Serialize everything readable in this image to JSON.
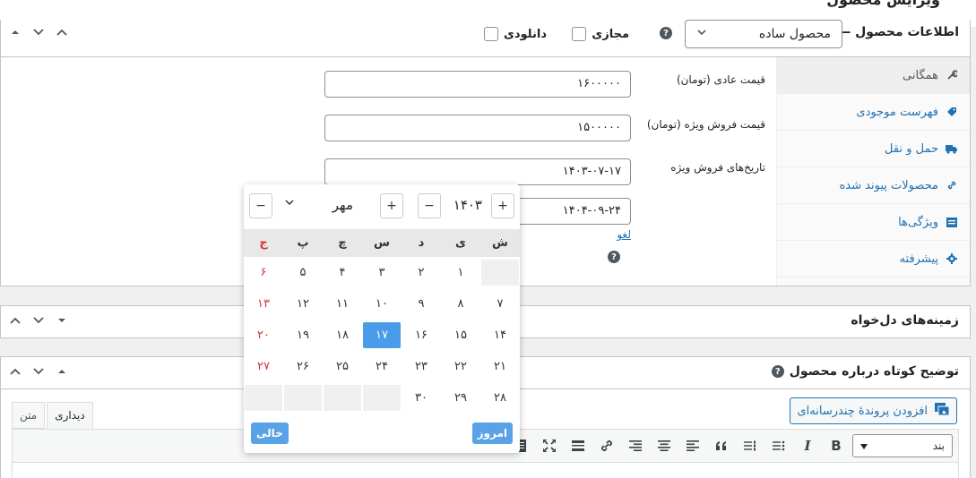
{
  "page": {
    "title": "ویرایش محصول"
  },
  "product_data": {
    "title": "اطلاعات محصول —",
    "type_select": "محصول ساده",
    "virtual_label": "مجازی",
    "downloadable_label": "دانلودی",
    "tabs": [
      {
        "label": "همگانی",
        "icon": "wrench-icon"
      },
      {
        "label": "فهرست موجودی",
        "icon": "tag-icon"
      },
      {
        "label": "حمل و نقل",
        "icon": "truck-icon"
      },
      {
        "label": "محصولات پیوند شده",
        "icon": "link-icon"
      },
      {
        "label": "ویژگی‌ها",
        "icon": "list-icon"
      },
      {
        "label": "پیشرفته",
        "icon": "gear-icon"
      }
    ],
    "regular_price_label": "قیمت عادی (تومان)",
    "regular_price_value": "۱۶۰۰۰۰۰",
    "sale_price_label": "قیمت فروش ویژه (تومان)",
    "sale_price_value": "۱۵۰۰۰۰۰",
    "sale_dates_label": "تاریخ‌های فروش ویژه",
    "sale_date_from": "۱۴۰۳-۰۷-۱۷",
    "sale_date_to": "۱۴۰۴-۰۹-۲۴",
    "cancel_link": "لغو"
  },
  "datepicker": {
    "year": "۱۴۰۳",
    "month": "مهر",
    "plus": "+",
    "minus": "−",
    "weekdays": [
      "ش",
      "ی",
      "د",
      "س",
      "چ",
      "پ",
      "ج"
    ],
    "weeks": [
      [
        "",
        "۱",
        "۲",
        "۳",
        "۴",
        "۵",
        "۶"
      ],
      [
        "۷",
        "۸",
        "۹",
        "۱۰",
        "۱۱",
        "۱۲",
        "۱۳"
      ],
      [
        "۱۴",
        "۱۵",
        "۱۶",
        "۱۷",
        "۱۸",
        "۱۹",
        "۲۰"
      ],
      [
        "۲۱",
        "۲۲",
        "۲۳",
        "۲۴",
        "۲۵",
        "۲۶",
        "۲۷"
      ],
      [
        "۲۸",
        "۲۹",
        "۳۰",
        "",
        "",
        "",
        ""
      ]
    ],
    "selected_day": "۱۷",
    "today_button": "امروز",
    "clear_button": "خالی"
  },
  "custom_fields": {
    "title": "زمینه‌های دل‌خواه"
  },
  "short_description": {
    "title": "توضیح کوتاه درباره محصول",
    "add_media": "افزودن پروندهٔ چندرسانه‌ای",
    "tab_visual": "دیداری",
    "tab_text": "متن",
    "format_select": "بند"
  }
}
